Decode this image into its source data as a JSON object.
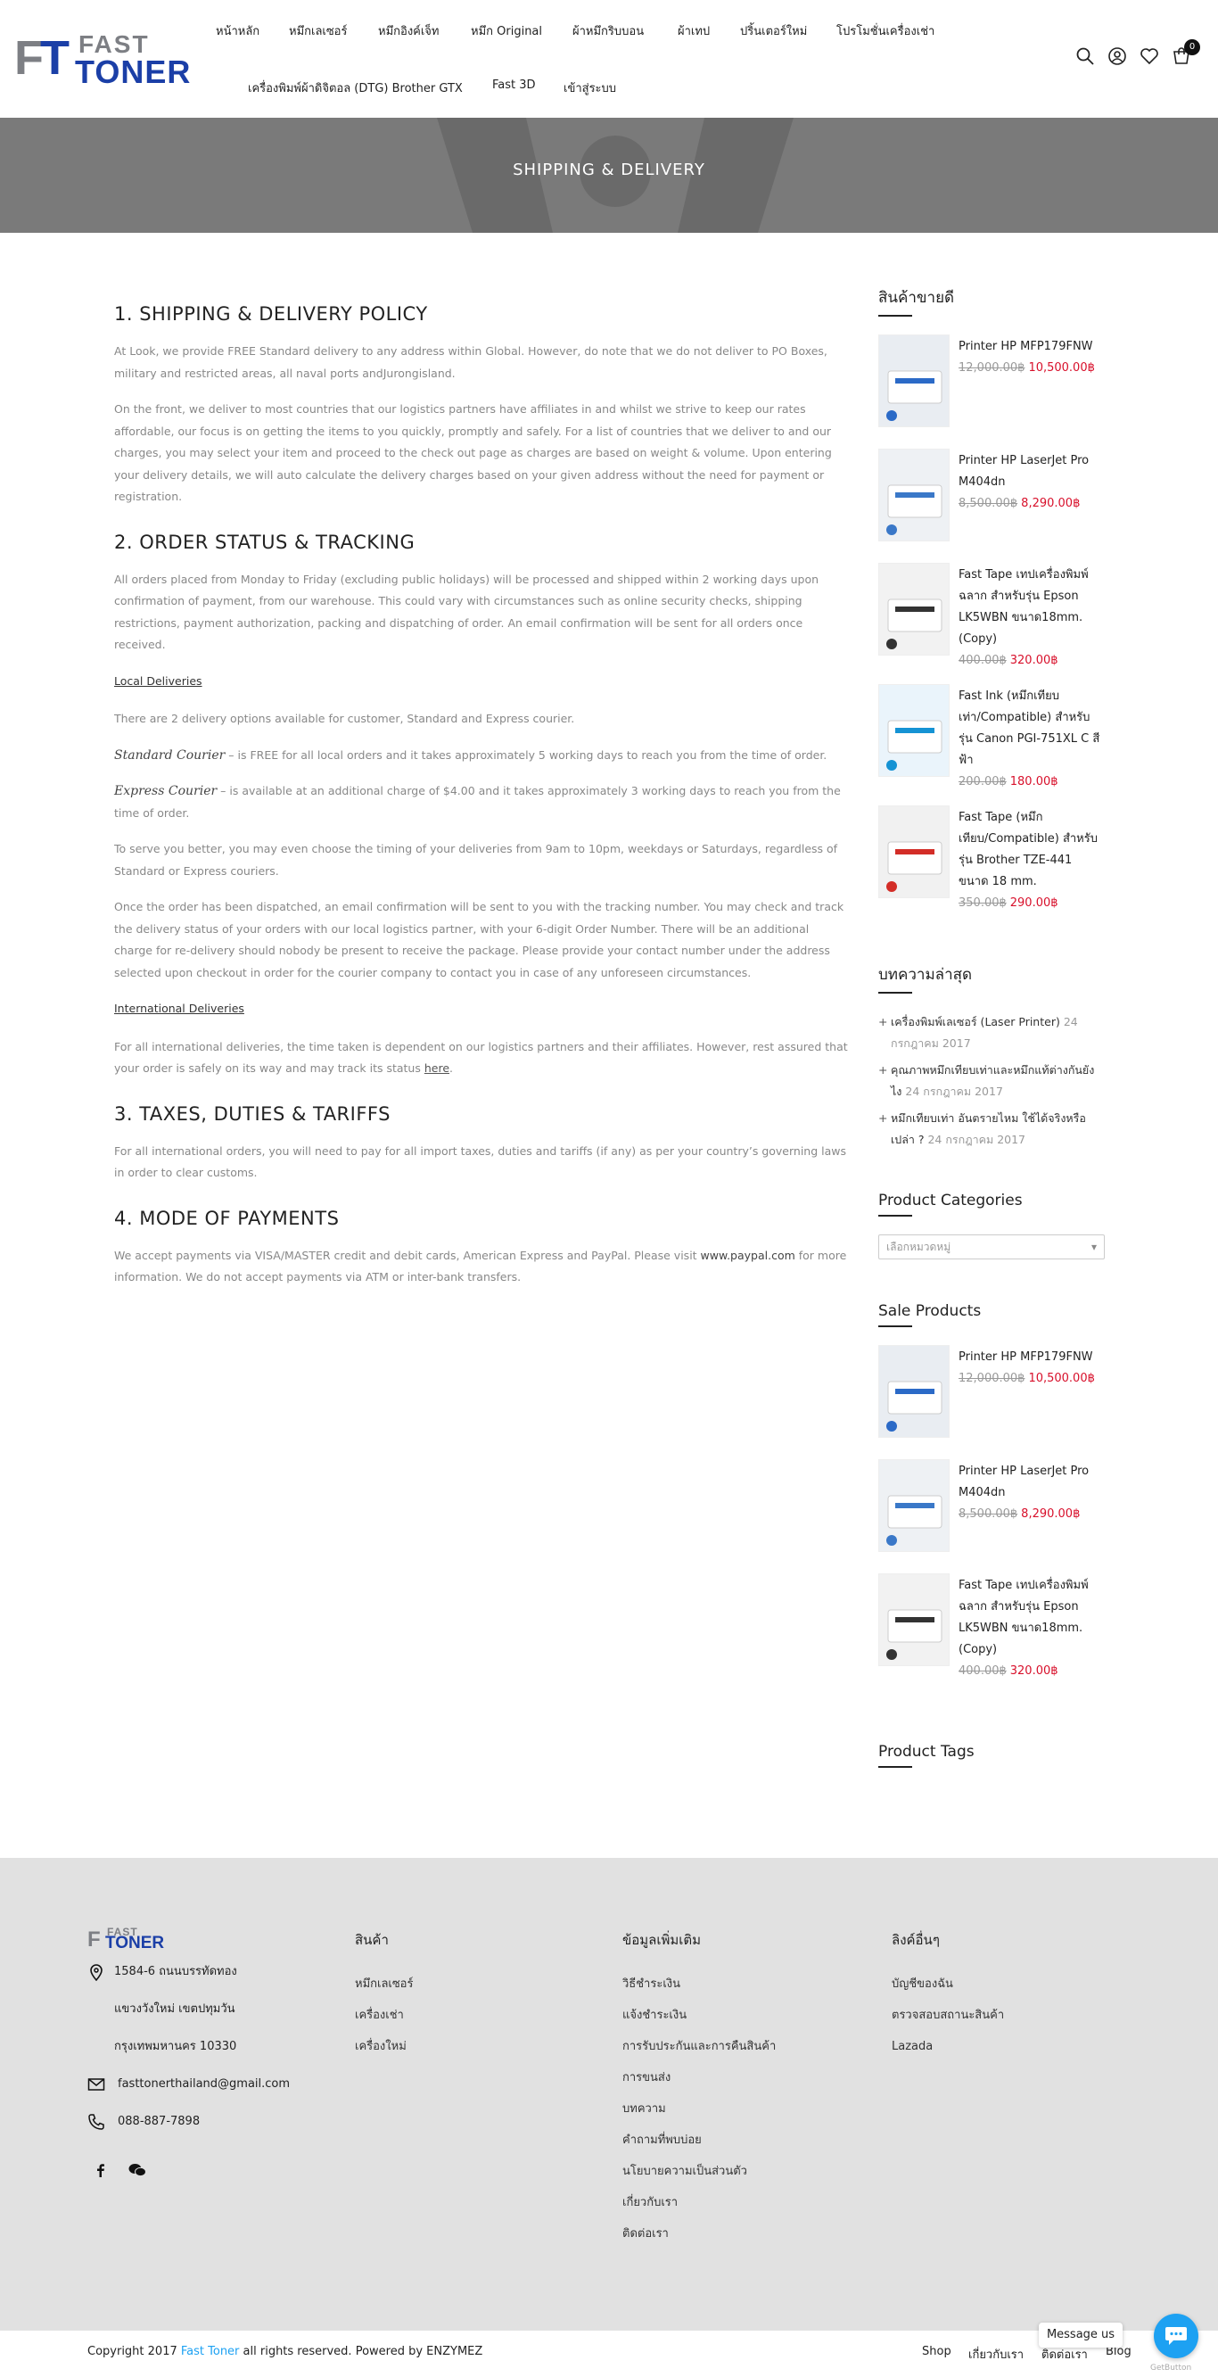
{
  "header": {
    "logo": {
      "fast": "FAST",
      "toner": "TONER"
    },
    "nav": [
      "หน้าหลัก",
      "หมึกเลเซอร์",
      "หมึกอิงค์เจ็ท",
      "หมึก Original",
      "ผ้าหมึกริบบอน",
      "ผ้าเทป",
      "ปริ้นเตอร์ใหม่",
      "โปรโมชั่นเครื่องเช่า",
      "เครื่องพิมพ์ผ้าดิจิตอล (DTG) Brother GTX",
      "Fast 3D",
      "เข้าสู่ระบบ"
    ],
    "cart_count": "0",
    "icons": [
      "search-icon",
      "user-icon",
      "heart-icon",
      "cart-icon"
    ]
  },
  "banner": {
    "title": "SHIPPING & DELIVERY"
  },
  "content": {
    "s1_title": "1. SHIPPING & DELIVERY POLICY",
    "s1_p1": "At Look, we provide FREE Standard delivery to any address within Global. However, do note that we do not deliver to PO Boxes, military and restricted areas, all naval ports andJurongisland.",
    "s1_p2": "On the front, we deliver to most countries that our logistics partners have affiliates in and whilst we strive to keep our rates affordable, our focus is on getting the items to you quickly, promptly and safely. For a list of countries that we deliver to and our charges, you may select your item and proceed to the check out page as charges are based on weight & volume. Upon entering your delivery details, we will auto calculate the delivery charges based on your given address without the need for payment or registration.",
    "s2_title": "2. ORDER STATUS & TRACKING",
    "s2_p1": "All orders placed from Monday to Friday (excluding public holidays) will be processed and shipped within 2 working days upon confirmation of payment, from our warehouse. This could vary with circumstances such as online security checks, shipping restrictions, payment authorization, packing and dispatching of order. An email confirmation will be sent for all orders once received.",
    "local_label": "Local Deliveries",
    "local_p1": "There are 2 delivery options available for customer, Standard and Express courier.",
    "standard_label": "Standard Courier",
    "standard_text": " – is FREE for all local orders and it takes approximately 5 working days to reach you from the time of order.",
    "express_label": "Express Courier",
    "express_text": " – is available at an additional charge of $4.00 and it takes approximately 3 working days to reach you from the time of order.",
    "local_p2": "To serve you better, you may even choose the timing of your deliveries from 9am to 10pm, weekdays or Saturdays, regardless of Standard or Express couriers.",
    "local_p3": "Once the order has been dispatched, an email confirmation will be sent to you with the tracking number. You may check and track the delivery status of your orders with our local logistics partner, with your 6-digit Order Number. There will be an additional charge for re-delivery should nobody be present to receive the package. Please provide your contact number under the address selected upon checkout in order for the courier company to contact you in case of any unforeseen circumstances.",
    "intl_label": "International Deliveries",
    "intl_p1": "For all international deliveries, the time taken is dependent on our logistics partners and their affiliates. However, rest assured that your order is safely on its way and may track its status ",
    "intl_link": "here",
    "intl_end": ".",
    "s3_title": "3. TAXES, DUTIES & TARIFFS",
    "s3_p1": "For all international orders, you will need to pay for all import taxes, duties and tariffs (if any) as per your country’s governing laws in order to clear customs.",
    "s4_title": "4. MODE OF PAYMENTS",
    "s4_p1_a": "We accept payments via VISA/MASTER credit and debit cards, American Express and PayPal. Please visit ",
    "s4_link": "www.paypal.com",
    "s4_p1_b": " for more information. We do not accept payments via ATM or inter-bank transfers."
  },
  "sidebar": {
    "best_title": "สินค้าขายดี",
    "best": [
      {
        "name": "Printer HP MFP179FNW",
        "old": "12,000.00฿",
        "new": "10,500.00฿"
      },
      {
        "name": "Printer HP LaserJet Pro M404dn",
        "old": "8,500.00฿",
        "new": "8,290.00฿"
      },
      {
        "name": "Fast Tape เทปเครื่องพิมพ์ฉลาก สำหรับรุ่น Epson LK5WBN ขนาด18mm. (Copy)",
        "old": "400.00฿",
        "new": "320.00฿"
      },
      {
        "name": "Fast Ink (หมึกเทียบเท่า/Compatible) สำหรับรุ่น Canon PGI-751XL C สีฟ้า",
        "old": "200.00฿",
        "new": "180.00฿"
      },
      {
        "name": "Fast Tape (หมึกเทียบ/Compatible) สำหรับรุ่น Brother TZE-441 ขนาด 18 mm.",
        "old": "350.00฿",
        "new": "290.00฿"
      }
    ],
    "posts_title": "บทความล่าสุด",
    "posts": [
      {
        "title": "เครื่องพิมพ์เลเซอร์ (Laser Printer)",
        "date": "24 กรกฎาคม 2017"
      },
      {
        "title": "คุณภาพหมึกเทียบเท่าและหมึกแท้ต่างกันยังไง",
        "date": "24 กรกฎาคม 2017"
      },
      {
        "title": "หมึกเทียบเท่า อันตรายไหม ใช้ได้จริงหรือเปล่า ?",
        "date": "24 กรกฎาคม 2017"
      }
    ],
    "cats_title": "Product Categories",
    "cats_placeholder": "เลือกหมวดหมู่",
    "sale_title": "Sale Products",
    "sale": [
      {
        "name": "Printer HP MFP179FNW",
        "old": "12,000.00฿",
        "new": "10,500.00฿"
      },
      {
        "name": "Printer HP LaserJet Pro M404dn",
        "old": "8,500.00฿",
        "new": "8,290.00฿"
      },
      {
        "name": "Fast Tape เทปเครื่องพิมพ์ฉลาก สำหรับรุ่น Epson LK5WBN ขนาด18mm. (Copy)",
        "old": "400.00฿",
        "new": "320.00฿"
      }
    ],
    "tags_title": "Product Tags"
  },
  "footer": {
    "logo": {
      "fast": "FAST",
      "toner": "TONER"
    },
    "address1": "1584-6 ถนนบรรทัดทอง",
    "address2": "แขวงวังใหม่ เขตปทุมวัน",
    "address3": "กรุงเทพมหานคร 10330",
    "email": "fasttonerthailand@gmail.com",
    "phone": "088-887-7898",
    "col1_title": "สินค้า",
    "col1": [
      "หมึกเลเซอร์",
      "เครื่องเช่า",
      "เครื่องใหม่"
    ],
    "col2_title": "ข้อมูลเพิ่มเติม",
    "col2": [
      "วิธีชำระเงิน",
      "แจ้งชำระเงิน",
      "การรับประกันและการคืนสินค้า",
      "การขนส่ง",
      "บทความ",
      "คำถามที่พบบ่อย",
      "นโยบายความเป็นส่วนตัว",
      "เกี่ยวกับเรา",
      "ติดต่อเรา"
    ],
    "col3_title": "ลิงค์อื่นๆ",
    "col3": [
      "บัญชีของฉัน",
      "ตรวจสอบสถานะสินค้า",
      "Lazada"
    ]
  },
  "bottom": {
    "copy_a": "Copyright 2017 ",
    "copy_brand": "Fast Toner",
    "copy_b": " all rights reserved. Powered by ENZYMEZ",
    "links": [
      "Shop",
      "เกี่ยวกับเรา",
      "ติดต่อเรา",
      "Blog"
    ],
    "chat_label": "Message us",
    "getbutton": "GetButton"
  },
  "colors": {
    "accent": "#1da1f2",
    "brand": "#1b3fa7",
    "sale": "#d8102b",
    "banner": "#7a7a7a",
    "footer_bg": "#e1e1e1"
  }
}
